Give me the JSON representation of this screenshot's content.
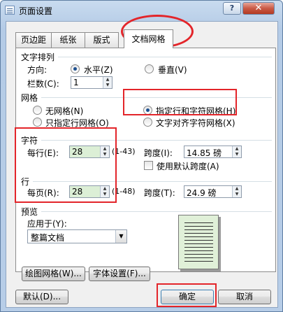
{
  "dialog": {
    "title": "页面设置",
    "help": "?",
    "close": "✕"
  },
  "tabs": [
    {
      "label": "页边距"
    },
    {
      "label": "纸张"
    },
    {
      "label": "版式"
    },
    {
      "label": "文档网格"
    }
  ],
  "text_direction": {
    "group": "文字排列",
    "direction_label": "方向:",
    "horizontal": "水平(Z)",
    "vertical": "垂直(V)",
    "columns_label": "栏数(C):",
    "columns_value": "1"
  },
  "grid": {
    "group": "网格",
    "no_grid": "无网格(N)",
    "lines_only": "只指定行网格(O)",
    "lines_and_chars": "指定行和字符网格(H)",
    "snap_to_chars": "文字对齐字符网格(X)",
    "selected": "lines_and_chars"
  },
  "characters": {
    "group": "字符",
    "per_line_label": "每行(E):",
    "per_line_value": "28",
    "per_line_range": "(1-43)",
    "pitch_label": "跨度(I):",
    "pitch_value": "14.85 磅",
    "use_default_pitch": "使用默认跨度(A)",
    "use_default_checked": false
  },
  "lines": {
    "group": "行",
    "per_page_label": "每页(R):",
    "per_page_value": "28",
    "per_page_range": "(1-48)",
    "pitch_label": "跨度(T):",
    "pitch_value": "24.9 磅"
  },
  "preview": {
    "group": "预览",
    "apply_to_label": "应用于(Y):",
    "apply_to_value": "整篇文档"
  },
  "buttons": {
    "draw_grid": "绘图网格(W)...",
    "font_settings": "字体设置(F)...",
    "default": "默认(D)...",
    "ok": "确定",
    "cancel": "取消"
  },
  "annotations": {
    "highlight_color": "#e3252a"
  }
}
